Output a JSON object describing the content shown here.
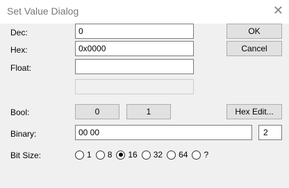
{
  "dialog": {
    "title": "Set Value Dialog",
    "close_glyph": "✕"
  },
  "labels": {
    "dec": "Dec:",
    "hex": "Hex:",
    "float": "Float:",
    "bool": "Bool:",
    "binary": "Binary:",
    "bit_size": "Bit Size:"
  },
  "fields": {
    "dec_value": "0",
    "hex_value": "0x0000",
    "float_value": "",
    "disabled_value": "",
    "binary_value": "00 00",
    "byte_count": "2"
  },
  "buttons": {
    "ok": "OK",
    "cancel": "Cancel",
    "bool_false": "0",
    "bool_true": "1",
    "hex_edit": "Hex Edit..."
  },
  "bit_size_options": [
    {
      "label": "1",
      "checked": false
    },
    {
      "label": "8",
      "checked": false
    },
    {
      "label": "16",
      "checked": true
    },
    {
      "label": "32",
      "checked": false
    },
    {
      "label": "64",
      "checked": false
    },
    {
      "label": "?",
      "checked": false
    }
  ],
  "colors": {
    "title_text": "#777777",
    "client_bg": "#f0f0f0",
    "button_bg": "#e1e1e1"
  }
}
